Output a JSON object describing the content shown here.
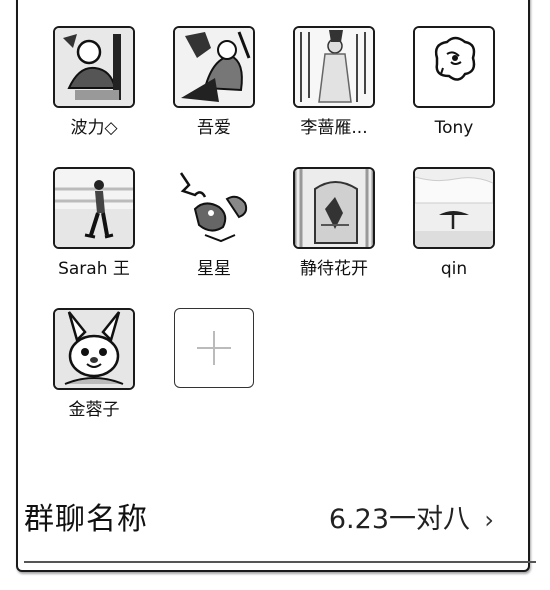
{
  "members": [
    {
      "name": "波力◇",
      "avatar": "cartoon-figure-avatar"
    },
    {
      "name": "吾爱",
      "avatar": "cartoon-pair-avatar"
    },
    {
      "name": "李蔷雁...",
      "avatar": "photo-person-avatar"
    },
    {
      "name": "Tony",
      "avatar": "flower-sketch-avatar"
    },
    {
      "name": "Sarah 王",
      "avatar": "walking-person-avatar"
    },
    {
      "name": "星星",
      "avatar": "animal-illustration-avatar"
    },
    {
      "name": "静待花开",
      "avatar": "landscape-photo-avatar"
    },
    {
      "name": "qin",
      "avatar": "sky-scene-avatar"
    },
    {
      "name": "金蓉子",
      "avatar": "cartoon-character-avatar"
    }
  ],
  "add_button": {
    "icon": "plus-icon"
  },
  "group_name": {
    "label": "群聊名称",
    "value": "6.23一对八",
    "chevron": "›"
  }
}
